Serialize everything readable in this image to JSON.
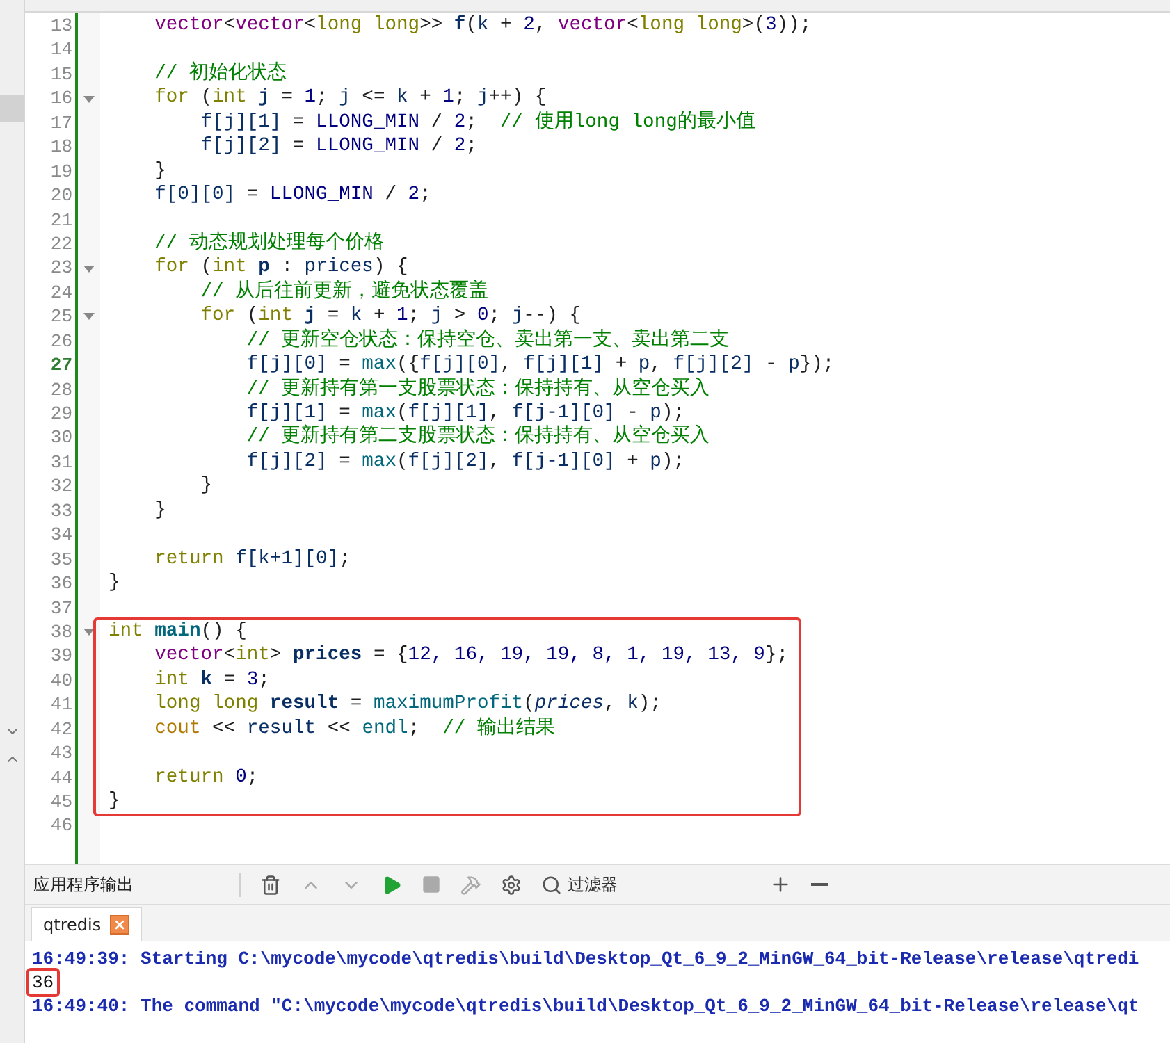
{
  "editor": {
    "blocks": [
      {
        "boxed": false,
        "lines": [
          {
            "number": "13",
            "foldable": false,
            "current": false,
            "tokens": [
              {
                "kind": "type",
                "text": "    vector"
              },
              {
                "kind": "plain",
                "text": "<"
              },
              {
                "kind": "type",
                "text": "vector"
              },
              {
                "kind": "plain",
                "text": "<"
              },
              {
                "kind": "keyword",
                "text": "long long"
              },
              {
                "kind": "plain",
                "text": ">> "
              },
              {
                "kind": "decl",
                "text": "f"
              },
              {
                "kind": "plain",
                "text": "("
              },
              {
                "kind": "var",
                "text": "k"
              },
              {
                "kind": "plain",
                "text": " + "
              },
              {
                "kind": "number",
                "text": "2"
              },
              {
                "kind": "plain",
                "text": ", "
              },
              {
                "kind": "type",
                "text": "vector"
              },
              {
                "kind": "plain",
                "text": "<"
              },
              {
                "kind": "keyword",
                "text": "long long"
              },
              {
                "kind": "plain",
                "text": ">("
              },
              {
                "kind": "number",
                "text": "3"
              },
              {
                "kind": "plain",
                "text": "));"
              }
            ]
          },
          {
            "number": "14",
            "foldable": false,
            "current": false
          },
          {
            "number": "15",
            "foldable": false,
            "current": false,
            "tokens": [
              {
                "kind": "comment",
                "text": "    // 初始化状态"
              }
            ]
          },
          {
            "number": "16",
            "foldable": true,
            "current": false,
            "tokens": [
              {
                "kind": "keyword",
                "text": "    for"
              },
              {
                "kind": "plain",
                "text": " ("
              },
              {
                "kind": "keyword",
                "text": "int"
              },
              {
                "kind": "decl",
                "text": " j"
              },
              {
                "kind": "plain",
                "text": " = "
              },
              {
                "kind": "number",
                "text": "1"
              },
              {
                "kind": "plain",
                "text": "; "
              },
              {
                "kind": "var",
                "text": "j"
              },
              {
                "kind": "plain",
                "text": " <= "
              },
              {
                "kind": "var",
                "text": "k"
              },
              {
                "kind": "plain",
                "text": " + "
              },
              {
                "kind": "number",
                "text": "1"
              },
              {
                "kind": "plain",
                "text": "; "
              },
              {
                "kind": "var",
                "text": "j"
              },
              {
                "kind": "plain",
                "text": "++) {"
              }
            ]
          },
          {
            "number": "17",
            "foldable": false,
            "current": false,
            "tokens": [
              {
                "kind": "var",
                "text": "        f[j][1]"
              },
              {
                "kind": "plain",
                "text": " = "
              },
              {
                "kind": "macro",
                "text": "LLONG_MIN"
              },
              {
                "kind": "plain",
                "text": " / "
              },
              {
                "kind": "number",
                "text": "2"
              },
              {
                "kind": "plain",
                "text": ";  "
              },
              {
                "kind": "comment",
                "text": "// 使用long long的最小值"
              }
            ]
          },
          {
            "number": "18",
            "foldable": false,
            "current": false,
            "tokens": [
              {
                "kind": "var",
                "text": "        f[j][2]"
              },
              {
                "kind": "plain",
                "text": " = "
              },
              {
                "kind": "macro",
                "text": "LLONG_MIN"
              },
              {
                "kind": "plain",
                "text": " / "
              },
              {
                "kind": "number",
                "text": "2"
              },
              {
                "kind": "plain",
                "text": ";"
              }
            ]
          },
          {
            "number": "19",
            "foldable": false,
            "current": false,
            "tokens": [
              {
                "kind": "plain",
                "text": "    }"
              }
            ]
          },
          {
            "number": "20",
            "foldable": false,
            "current": false,
            "tokens": [
              {
                "kind": "var",
                "text": "    f[0][0]"
              },
              {
                "kind": "plain",
                "text": " = "
              },
              {
                "kind": "macro",
                "text": "LLONG_MIN"
              },
              {
                "kind": "plain",
                "text": " / "
              },
              {
                "kind": "number",
                "text": "2"
              },
              {
                "kind": "plain",
                "text": ";"
              }
            ]
          },
          {
            "number": "21",
            "foldable": false,
            "current": false
          },
          {
            "number": "22",
            "foldable": false,
            "current": false,
            "tokens": [
              {
                "kind": "comment",
                "text": "    // 动态规划处理每个价格"
              }
            ]
          },
          {
            "number": "23",
            "foldable": true,
            "current": false,
            "tokens": [
              {
                "kind": "keyword",
                "text": "    for"
              },
              {
                "kind": "plain",
                "text": " ("
              },
              {
                "kind": "keyword",
                "text": "int"
              },
              {
                "kind": "decl",
                "text": " p"
              },
              {
                "kind": "plain",
                "text": " : "
              },
              {
                "kind": "var",
                "text": "prices"
              },
              {
                "kind": "plain",
                "text": ") {"
              }
            ]
          },
          {
            "number": "24",
            "foldable": false,
            "current": false,
            "tokens": [
              {
                "kind": "comment",
                "text": "        // 从后往前更新，避免状态覆盖"
              }
            ]
          },
          {
            "number": "25",
            "foldable": true,
            "current": false,
            "tokens": [
              {
                "kind": "keyword",
                "text": "        for"
              },
              {
                "kind": "plain",
                "text": " ("
              },
              {
                "kind": "keyword",
                "text": "int"
              },
              {
                "kind": "decl",
                "text": " j"
              },
              {
                "kind": "plain",
                "text": " = "
              },
              {
                "kind": "var",
                "text": "k"
              },
              {
                "kind": "plain",
                "text": " + "
              },
              {
                "kind": "number",
                "text": "1"
              },
              {
                "kind": "plain",
                "text": "; "
              },
              {
                "kind": "var",
                "text": "j"
              },
              {
                "kind": "plain",
                "text": " > "
              },
              {
                "kind": "number",
                "text": "0"
              },
              {
                "kind": "plain",
                "text": "; "
              },
              {
                "kind": "var",
                "text": "j"
              },
              {
                "kind": "plain",
                "text": "--) {"
              }
            ]
          },
          {
            "number": "26",
            "foldable": false,
            "current": false,
            "tokens": [
              {
                "kind": "comment",
                "text": "            // 更新空仓状态：保持空仓、卖出第一支、卖出第二支"
              }
            ]
          },
          {
            "number": "27",
            "foldable": false,
            "current": true,
            "tokens": [
              {
                "kind": "var",
                "text": "            f[j][0]"
              },
              {
                "kind": "plain",
                "text": " = "
              },
              {
                "kind": "func",
                "text": "max"
              },
              {
                "kind": "plain",
                "text": "({"
              },
              {
                "kind": "var",
                "text": "f[j][0]"
              },
              {
                "kind": "plain",
                "text": ", "
              },
              {
                "kind": "var",
                "text": "f[j][1]"
              },
              {
                "kind": "plain",
                "text": " + "
              },
              {
                "kind": "var",
                "text": "p"
              },
              {
                "kind": "plain",
                "text": ", "
              },
              {
                "kind": "var",
                "text": "f[j][2]"
              },
              {
                "kind": "plain",
                "text": " - "
              },
              {
                "kind": "var",
                "text": "p"
              },
              {
                "kind": "plain",
                "text": "});"
              }
            ]
          },
          {
            "number": "28",
            "foldable": false,
            "current": false,
            "tokens": [
              {
                "kind": "comment",
                "text": "            // 更新持有第一支股票状态：保持持有、从空仓买入"
              }
            ]
          },
          {
            "number": "29",
            "foldable": false,
            "current": false,
            "tokens": [
              {
                "kind": "var",
                "text": "            f[j][1]"
              },
              {
                "kind": "plain",
                "text": " = "
              },
              {
                "kind": "func",
                "text": "max"
              },
              {
                "kind": "plain",
                "text": "("
              },
              {
                "kind": "var",
                "text": "f[j][1]"
              },
              {
                "kind": "plain",
                "text": ", "
              },
              {
                "kind": "var",
                "text": "f[j-1][0]"
              },
              {
                "kind": "plain",
                "text": " - "
              },
              {
                "kind": "var",
                "text": "p"
              },
              {
                "kind": "plain",
                "text": ");"
              }
            ]
          },
          {
            "number": "30",
            "foldable": false,
            "current": false,
            "tokens": [
              {
                "kind": "comment",
                "text": "            // 更新持有第二支股票状态：保持持有、从空仓买入"
              }
            ]
          },
          {
            "number": "31",
            "foldable": false,
            "current": false,
            "tokens": [
              {
                "kind": "var",
                "text": "            f[j][2]"
              },
              {
                "kind": "plain",
                "text": " = "
              },
              {
                "kind": "func",
                "text": "max"
              },
              {
                "kind": "plain",
                "text": "("
              },
              {
                "kind": "var",
                "text": "f[j][2]"
              },
              {
                "kind": "plain",
                "text": ", "
              },
              {
                "kind": "var",
                "text": "f[j-1][0]"
              },
              {
                "kind": "plain",
                "text": " + "
              },
              {
                "kind": "var",
                "text": "p"
              },
              {
                "kind": "plain",
                "text": ");"
              }
            ]
          },
          {
            "number": "32",
            "foldable": false,
            "current": false,
            "tokens": [
              {
                "kind": "plain",
                "text": "        }"
              }
            ]
          },
          {
            "number": "33",
            "foldable": false,
            "current": false,
            "tokens": [
              {
                "kind": "plain",
                "text": "    }"
              }
            ]
          },
          {
            "number": "34",
            "foldable": false,
            "current": false
          },
          {
            "number": "35",
            "foldable": false,
            "current": false,
            "tokens": [
              {
                "kind": "keyword",
                "text": "    return"
              },
              {
                "kind": "var",
                "text": " f[k+1][0]"
              },
              {
                "kind": "plain",
                "text": ";"
              }
            ]
          },
          {
            "number": "36",
            "foldable": false,
            "current": false,
            "tokens": [
              {
                "kind": "plain",
                "text": "}"
              }
            ]
          },
          {
            "number": "37",
            "foldable": false,
            "current": false
          }
        ]
      },
      {
        "boxed": true,
        "lines": [
          {
            "number": "38",
            "foldable": true,
            "current": false,
            "tokens": [
              {
                "kind": "keyword",
                "text": "int"
              },
              {
                "kind": "funcdecl",
                "text": " main"
              },
              {
                "kind": "plain",
                "text": "() {"
              }
            ]
          },
          {
            "number": "39",
            "foldable": false,
            "current": false,
            "tokens": [
              {
                "kind": "type",
                "text": "    vector"
              },
              {
                "kind": "plain",
                "text": "<"
              },
              {
                "kind": "keyword",
                "text": "int"
              },
              {
                "kind": "plain",
                "text": "> "
              },
              {
                "kind": "decl",
                "text": "prices"
              },
              {
                "kind": "plain",
                "text": " = {"
              },
              {
                "kind": "number",
                "text": "12, 16, 19, 19, 8, 1, 19, 13, 9"
              },
              {
                "kind": "plain",
                "text": "};"
              }
            ]
          },
          {
            "number": "40",
            "foldable": false,
            "current": false,
            "tokens": [
              {
                "kind": "keyword",
                "text": "    int"
              },
              {
                "kind": "decl",
                "text": " k"
              },
              {
                "kind": "plain",
                "text": " = "
              },
              {
                "kind": "number",
                "text": "3"
              },
              {
                "kind": "plain",
                "text": ";"
              }
            ]
          },
          {
            "number": "41",
            "foldable": false,
            "current": false,
            "tokens": [
              {
                "kind": "keyword",
                "text": "    long long"
              },
              {
                "kind": "decl",
                "text": " result"
              },
              {
                "kind": "plain",
                "text": " = "
              },
              {
                "kind": "func",
                "text": "maximumProfit"
              },
              {
                "kind": "plain",
                "text": "("
              },
              {
                "kind": "param",
                "text": "prices"
              },
              {
                "kind": "plain",
                "text": ", "
              },
              {
                "kind": "var",
                "text": "k"
              },
              {
                "kind": "plain",
                "text": ");"
              }
            ]
          },
          {
            "number": "42",
            "foldable": false,
            "current": false,
            "tokens": [
              {
                "kind": "stream",
                "text": "    cout"
              },
              {
                "kind": "plain",
                "text": " << "
              },
              {
                "kind": "var",
                "text": "result"
              },
              {
                "kind": "plain",
                "text": " << "
              },
              {
                "kind": "func",
                "text": "endl"
              },
              {
                "kind": "plain",
                "text": ";  "
              },
              {
                "kind": "comment",
                "text": "// 输出结果"
              }
            ]
          },
          {
            "number": "43",
            "foldable": false,
            "current": false
          },
          {
            "number": "44",
            "foldable": false,
            "current": false,
            "tokens": [
              {
                "kind": "keyword",
                "text": "    return"
              },
              {
                "kind": "number",
                "text": " 0"
              },
              {
                "kind": "plain",
                "text": ";"
              }
            ]
          },
          {
            "number": "45",
            "foldable": false,
            "current": false,
            "tokens": [
              {
                "kind": "plain",
                "text": "}"
              }
            ]
          }
        ]
      },
      {
        "boxed": false,
        "lines": [
          {
            "number": "46",
            "foldable": false,
            "current": false
          }
        ]
      }
    ]
  },
  "output_panel": {
    "title": "应用程序输出",
    "filter": {
      "placeholder": "过滤器"
    },
    "tabs": [
      {
        "label": "qtredis",
        "selected": true
      }
    ],
    "lines": [
      {
        "text": "16:49:39: Starting C:\\mycode\\mycode\\qtredis\\build\\Desktop_Qt_6_9_2_MinGW_64_bit-Release\\release\\qtredi",
        "kind": "message",
        "boxed": false
      },
      {
        "text": "36",
        "kind": "stdout",
        "boxed": true
      },
      {
        "text": "16:49:40: The command \"C:\\mycode\\mycode\\qtredis\\build\\Desktop_Qt_6_9_2_MinGW_64_bit-Release\\release\\qt",
        "kind": "message",
        "boxed": false
      }
    ]
  }
}
